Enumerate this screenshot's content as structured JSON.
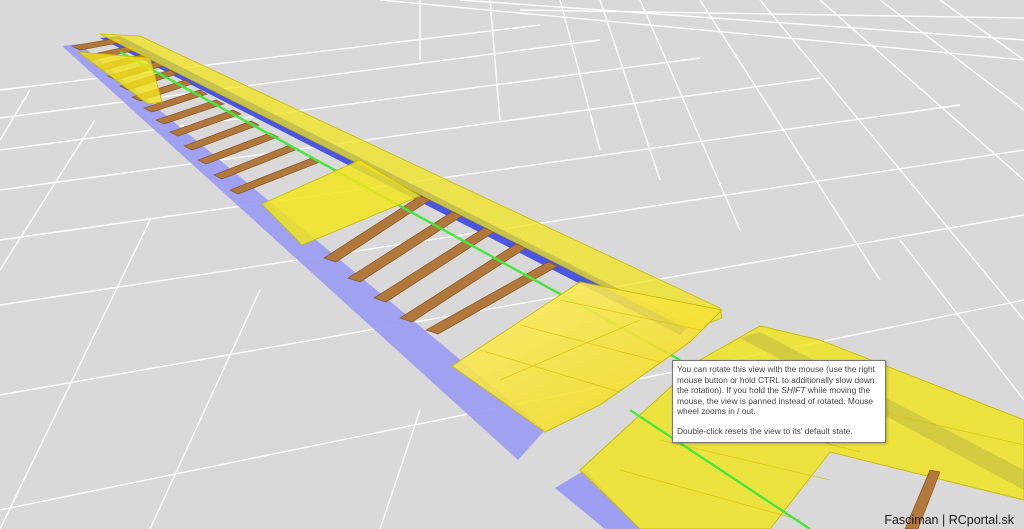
{
  "tooltip": {
    "line1_a": "You can rotate this view with the mouse (use the right mouse button or hold CTRL to additionally slow down the rotation). If you hold the ",
    "line1_shift": "SHIFT",
    "line1_b": " while moving the mouse, the view is panned instead of rotated. Mouse wheel zooms in / out.",
    "line2": "Double-click resets the view to its' default state."
  },
  "watermark": "Fasciman | RCportal.sk",
  "colors": {
    "background": "#d9d9d9",
    "grid": "#ffffff",
    "sheeting": "#f2e51c",
    "rib": "#b2773a",
    "spar": "#4a56e0",
    "trailing_edge": "#9e9ef2",
    "carbon_rod": "#46e83c"
  },
  "icons": [
    "wing-3d-model"
  ]
}
